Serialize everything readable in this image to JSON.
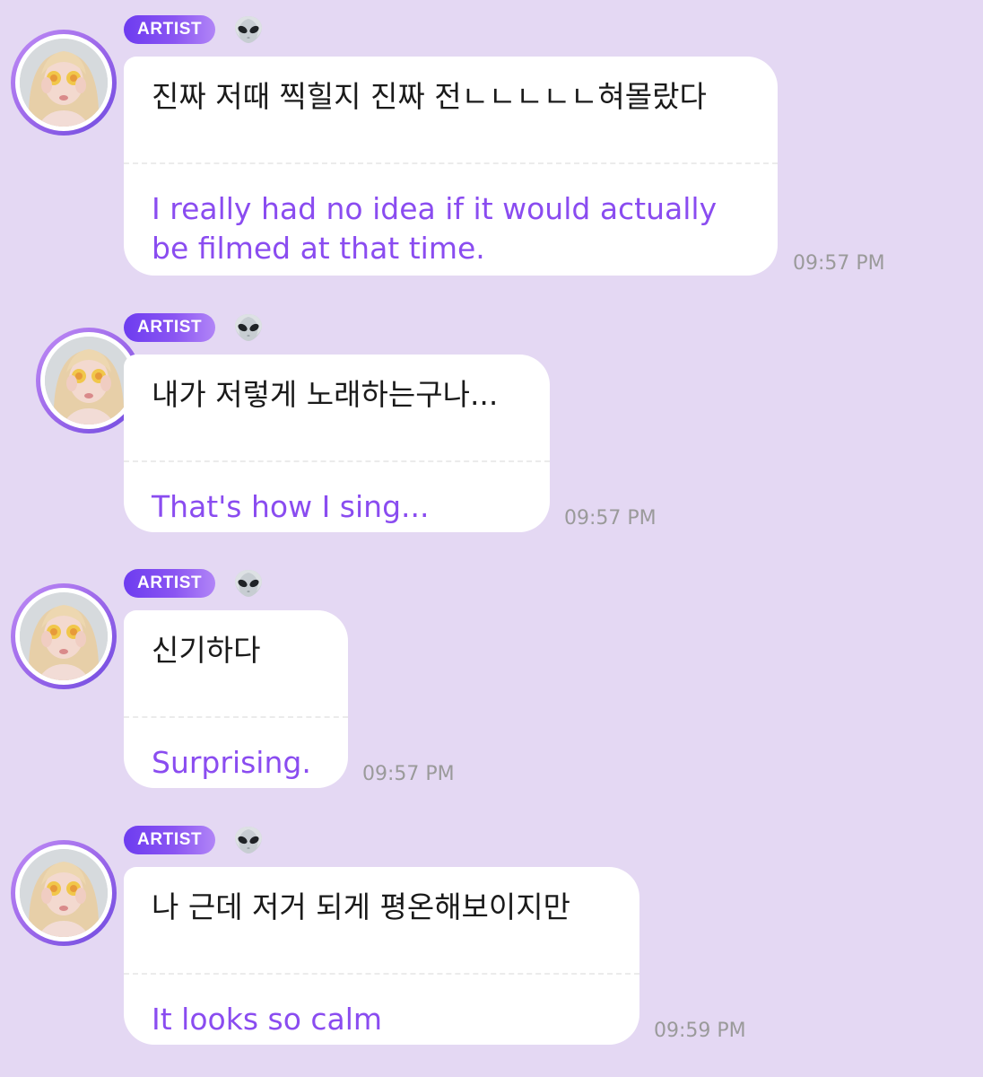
{
  "messages": [
    {
      "badge": "ARTIST",
      "icon": "alien-icon",
      "original": "진짜 저때 찍힐지 진짜 전ㄴㄴㄴㄴㄴ혀몰랐다",
      "translation_lines": [
        "I really had no idea if it would actually",
        "be filmed at that time."
      ],
      "time": "09:57 PM"
    },
    {
      "badge": "ARTIST",
      "icon": "alien-icon",
      "original": "내가 저렇게 노래하는구나...",
      "translation_lines": [
        "That's how I sing..."
      ],
      "time": "09:57 PM"
    },
    {
      "badge": "ARTIST",
      "icon": "alien-icon",
      "original": "신기하다",
      "translation_lines": [
        "Surprising."
      ],
      "time": "09:57 PM"
    },
    {
      "badge": "ARTIST",
      "icon": "alien-icon",
      "original": "나 근데 저거 되게 평온해보이지만",
      "translation_lines": [
        "It looks so calm"
      ],
      "time": "09:59 PM"
    }
  ],
  "colors": {
    "background": "#e4d8f3",
    "translation_text": "#8a4cf0",
    "badge_start": "#6d3cf0",
    "badge_end": "#b185f7",
    "timestamp": "#9a9a9a"
  }
}
